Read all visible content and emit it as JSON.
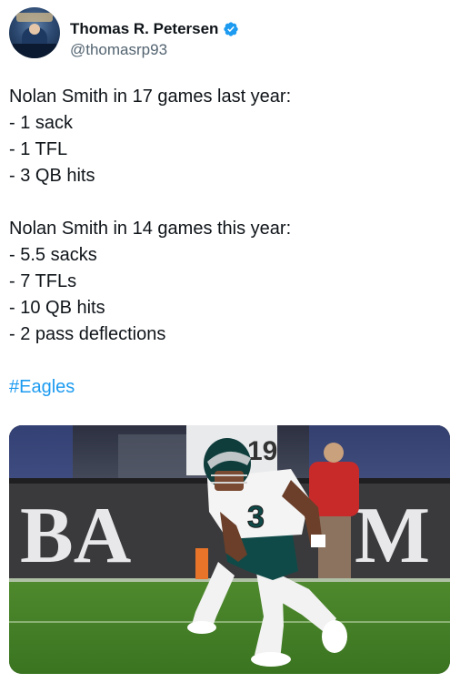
{
  "author": {
    "name": "Thomas R. Petersen",
    "handle": "@thomasrp93",
    "avatar_icon": "profile-photo",
    "verified_icon": "verified-badge-icon",
    "verified_color": "#1d9bf0"
  },
  "tweet": {
    "block1": {
      "heading": "Nolan Smith in 17 games last year:",
      "items": [
        "- 1 sack",
        "- 1 TFL",
        "- 3 QB hits"
      ]
    },
    "block2": {
      "heading": "Nolan Smith in 14 games this year:",
      "items": [
        "- 5.5 sacks",
        "- 7 TFLs",
        "- 10 QB hits",
        "- 2 pass deflections"
      ]
    },
    "hashtag": "#Eagles",
    "hashtag_color": "#1d9bf0"
  },
  "media": {
    "banner_text": "BA",
    "banner_text_right": "M",
    "jersey_number": "3",
    "background_jersey_number": "19"
  }
}
